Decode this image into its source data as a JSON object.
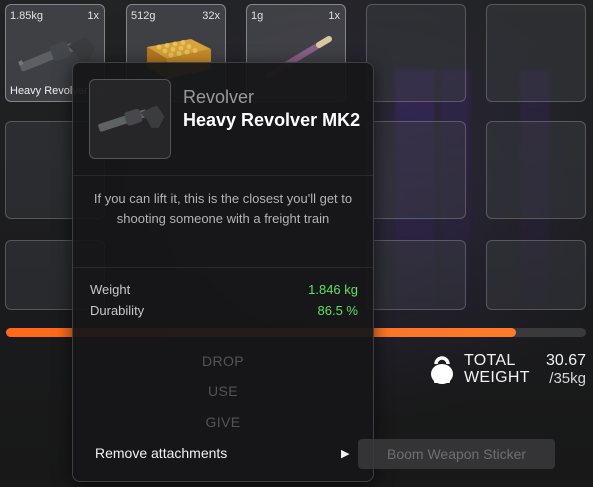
{
  "inventory": {
    "slots": [
      {
        "weight": "1.85kg",
        "qty": "1x",
        "name": "Heavy Revolver MK2",
        "icon": "revolver-icon"
      },
      {
        "weight": "512g",
        "qty": "32x",
        "name": "",
        "icon": "ammo-box-icon"
      },
      {
        "weight": "1g",
        "qty": "1x",
        "name": "",
        "icon": "joint-icon"
      }
    ],
    "colors": {
      "accent": "#ff6a1a",
      "stat_value": "#5ee35e",
      "muted": "#545456"
    }
  },
  "weight": {
    "fill_fraction": 0.88,
    "label": "TOTAL WEIGHT",
    "current": "30.67",
    "max": "/35kg",
    "icon": "kettlebell-icon"
  },
  "tooltip": {
    "category": "Revolver",
    "title": "Heavy Revolver MK2",
    "description": "If you can lift it, this is the closest you'll get to shooting someone with a freight train",
    "stats": [
      {
        "label": "Weight",
        "value": "1.846 kg"
      },
      {
        "label": "Durability",
        "value": "86.5 %"
      }
    ],
    "actions": [
      "DROP",
      "USE",
      "GIVE"
    ],
    "remove_label": "Remove attachments",
    "submenu_item": "Boom Weapon Sticker"
  }
}
